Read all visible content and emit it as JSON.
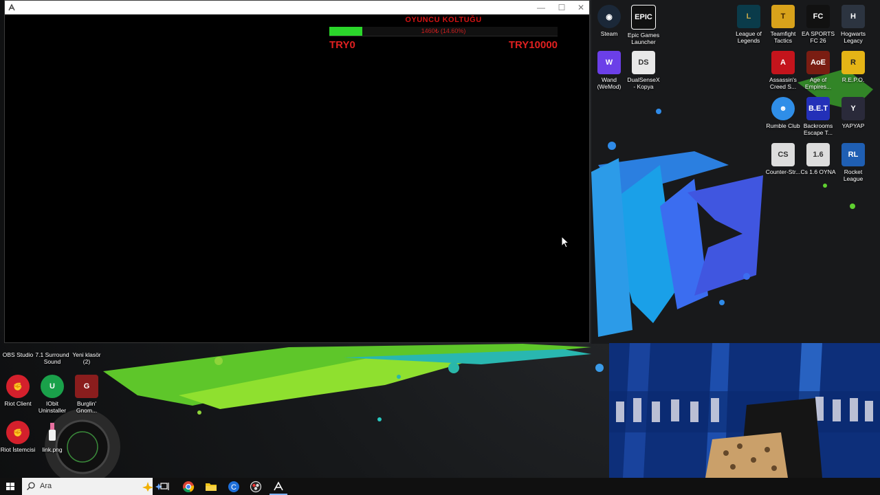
{
  "app": {
    "seat_title": "OYUNCU KOLTUĞU",
    "progress_text": "1460₺ (14.60%)",
    "progress_fraction": 0.146,
    "min_label": "TRY0",
    "max_label": "TRY10000"
  },
  "colors": {
    "progress_fill": "#2bd62b",
    "label_red": "#e02020"
  },
  "desktop_icons_right": [
    {
      "label": "Steam",
      "icon": "steam-icon"
    },
    {
      "label": "Epic Games Launcher",
      "icon": "epic-games-icon"
    },
    {
      "label": "League of Legends",
      "icon": "league-of-legends-icon"
    },
    {
      "label": "Teamfight Tactics",
      "icon": "teamfight-tactics-icon"
    },
    {
      "label": "EA SPORTS FC 26",
      "icon": "ea-sports-fc-icon"
    },
    {
      "label": "Hogwarts Legacy",
      "icon": "hogwarts-legacy-icon"
    },
    {
      "label": "Wand (WeMod)",
      "icon": "wemod-icon"
    },
    {
      "label": "DualSenseX - Kopya",
      "icon": "dualsensex-icon"
    },
    {
      "label": "Assassin's Creed S...",
      "icon": "assassins-creed-icon"
    },
    {
      "label": "Age of Empires...",
      "icon": "age-of-empires-icon"
    },
    {
      "label": "R.E.P.O.",
      "icon": "repo-icon"
    },
    {
      "label": "Rumble Club",
      "icon": "rumble-club-icon"
    },
    {
      "label": "Backrooms Escape T...",
      "icon": "backrooms-icon"
    },
    {
      "label": "YAPYAP",
      "icon": "yapyap-icon"
    },
    {
      "label": "Counter-Str...",
      "icon": "counter-strike-icon"
    },
    {
      "label": "Cs 1.6 OYNA",
      "icon": "cs16-icon"
    },
    {
      "label": "Rocket League",
      "icon": "rocket-league-icon"
    }
  ],
  "desktop_icons_left": [
    {
      "label": "OBS Studio",
      "icon": "obs-icon"
    },
    {
      "label": "7.1 Surround Sound",
      "icon": "surround-sound-icon"
    },
    {
      "label": "Yeni klasör (2)",
      "icon": "folder-icon"
    },
    {
      "label": "Riot Client",
      "icon": "riot-client-icon"
    },
    {
      "label": "IObit Uninstaller",
      "icon": "iobit-icon"
    },
    {
      "label": "Burglin' Gnom...",
      "icon": "burglin-gnomes-icon"
    },
    {
      "label": "Riot İstemcisi",
      "icon": "riot-istemcisi-icon"
    },
    {
      "label": "link.png",
      "icon": "png-file-icon"
    }
  ],
  "taskbar": {
    "search_placeholder": "Ara",
    "pinned": [
      "task-view-icon",
      "chrome-icon",
      "file-explorer-icon",
      "ccleaner-icon",
      "obs-taskbar-icon",
      "app-taskbar-icon"
    ]
  }
}
